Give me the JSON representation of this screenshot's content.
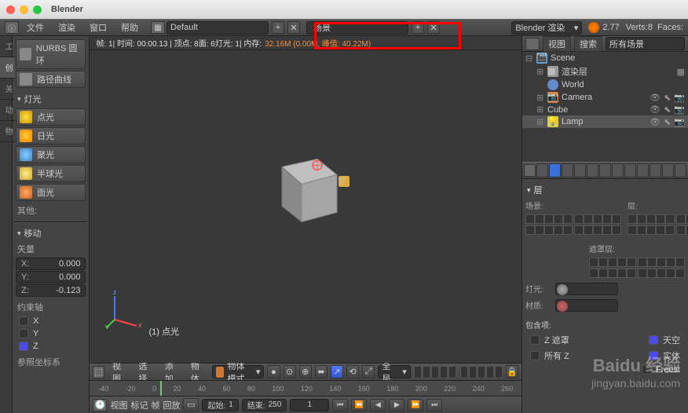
{
  "app": {
    "title": "Blender"
  },
  "topmenu": {
    "file": "文件",
    "render": "渲染",
    "window": "窗口",
    "help": "帮助",
    "layout": "Default",
    "scene": "场景",
    "engine": "Blender 渲染",
    "version": "2.77",
    "verts": "Verts:8",
    "faces": "Faces:"
  },
  "left": {
    "item1": "NURBS 圆环",
    "item2": "路径曲线",
    "lights_hdr": "灯光",
    "point": "点光",
    "sun": "日光",
    "spot": "聚光",
    "hemi": "半球光",
    "area": "面光",
    "other": "其他:",
    "move_hdr": "移动",
    "vector": "矢量",
    "x_lbl": "X:",
    "x_val": "0.000",
    "y_lbl": "Y:",
    "y_val": "0.000",
    "z_lbl": "Z:",
    "z_val": "-0.123",
    "constraint": "约束轴",
    "cx": "X",
    "cy": "Y",
    "cz": "Z",
    "ref": "参照坐标系"
  },
  "vp": {
    "stats": "帧: 1| 时间: 00:00.13 | 顶点: 8面: 6灯光: 1| 内存:",
    "mem": "32.16M (0.00M, 峰值: 40.22M)",
    "label": "(1) 点光",
    "view": "视图",
    "select": "选择",
    "add": "添加",
    "object": "物体",
    "mode": "物体模式",
    "global": "全局"
  },
  "timeline": {
    "t0": "-40",
    "t1": "-20",
    "t2": "0",
    "t3": "20",
    "t4": "40",
    "t5": "60",
    "t6": "80",
    "t7": "100",
    "t8": "120",
    "t9": "140",
    "t10": "160",
    "t11": "180",
    "t12": "200",
    "t13": "220",
    "t14": "240",
    "t15": "260",
    "view": "视图",
    "marker": "标记",
    "frame": "帧",
    "playback": "回放",
    "start_lbl": "起始:",
    "start_val": "1",
    "end_lbl": "结束:",
    "end_val": "250",
    "cur_val": "1",
    "freest": "Freest"
  },
  "outliner": {
    "view": "视图",
    "search": "搜索",
    "all": "所有场景",
    "scene": "Scene",
    "renderlayer": "渲染层",
    "world": "World",
    "camera": "Camera",
    "cube": "Cube",
    "lamp": "Lamp"
  },
  "props": {
    "layers_hdr": "层",
    "scene_lbl": "场景:",
    "layer_lbl": "层:",
    "mask_lbl": "遮罩层:",
    "light_lbl": "灯光:",
    "mat_lbl": "材质:",
    "include_hdr": "包含项:",
    "zmask": "Z 遮罩",
    "sky": "天空",
    "all": "所有 Z",
    "solid_placeholder": "实体"
  },
  "watermark": {
    "brand": "Baidu 经验",
    "url": "jingyan.baidu.com"
  }
}
